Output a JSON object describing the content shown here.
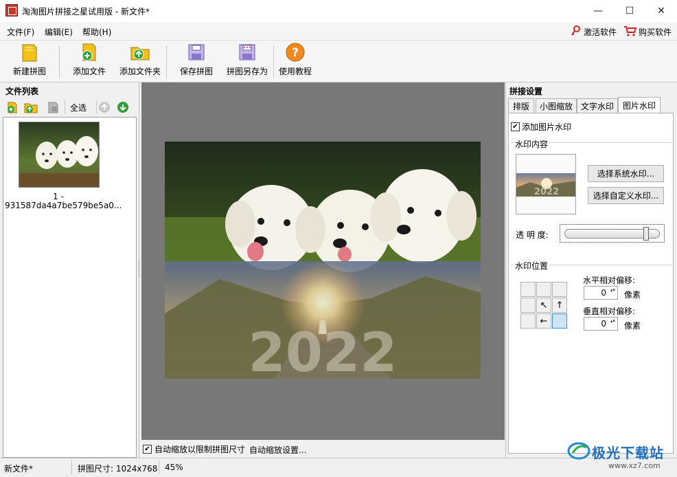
{
  "window": {
    "title": "淘淘图片拼接之星试用版 - 新文件*",
    "minimize": "—",
    "maximize": "☐",
    "close": "✕"
  },
  "menu": {
    "file": "文件(F)",
    "edit": "编辑(E)",
    "help": "帮助(H)",
    "activate": "激活软件",
    "buy": "购买软件"
  },
  "toolbar": {
    "new": "新建拼图",
    "add_file": "添加文件",
    "add_folder": "添加文件夹",
    "save": "保存拼图",
    "save_as": "拼图另存为",
    "tutorial": "使用教程"
  },
  "left": {
    "title": "文件列表",
    "select_all": "全选",
    "file_name_1": "1 -",
    "file_name_2": "931587da4a7be579be5a0..."
  },
  "bottom": {
    "auto_scale_label": "自动缩放以限制拼图尺寸",
    "auto_scale_settings": "自动缩放设置..."
  },
  "right": {
    "title": "拼接设置",
    "tabs": [
      "排版",
      "小图缩放",
      "文字水印",
      "图片水印"
    ],
    "add_watermark": "添加图片水印",
    "content_group": "水印内容",
    "select_system": "选择系统水印...",
    "select_custom": "选择自定义水印...",
    "transparency_label": "透 明 度:",
    "transparency_level": 0.88,
    "position_group": "水印位置",
    "h_offset_label": "水平相对偏移:",
    "h_offset_value": "0",
    "v_offset_label": "垂直相对偏移:",
    "v_offset_value": "0",
    "pixel_unit": "像素",
    "watermark_text": "2022"
  },
  "status": {
    "file": "新文件*",
    "size": "拼图尺寸: 1024x768",
    "zoom": "45%"
  },
  "brand": {
    "watermark_logo": "极光下载站",
    "watermark_url": "www.xz7.com"
  }
}
